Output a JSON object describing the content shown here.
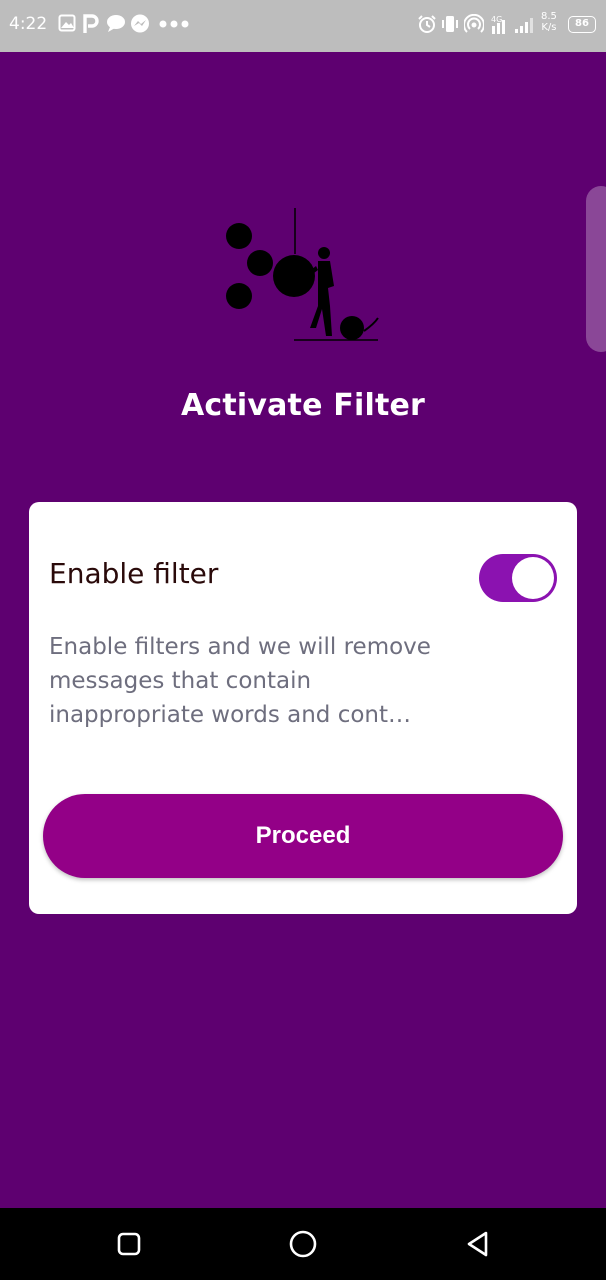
{
  "status_bar": {
    "time": "4:22",
    "speed_value": "8.5",
    "speed_unit": "K/s",
    "battery": "86",
    "network": "4G"
  },
  "screen": {
    "title": "Activate Filter",
    "illustration_icon": "person-with-balls-illustration"
  },
  "card": {
    "toggle_label": "Enable filter",
    "toggle_on": true,
    "description": "Enable filters and we will remove messages that contain inappropriate words and cont…",
    "proceed_label": "Proceed"
  },
  "colors": {
    "background": "#5e0070",
    "accent": "#930087",
    "toggle": "#8b12b0"
  },
  "nav": {
    "recents_icon": "square-icon",
    "home_icon": "circle-icon",
    "back_icon": "triangle-back-icon"
  }
}
